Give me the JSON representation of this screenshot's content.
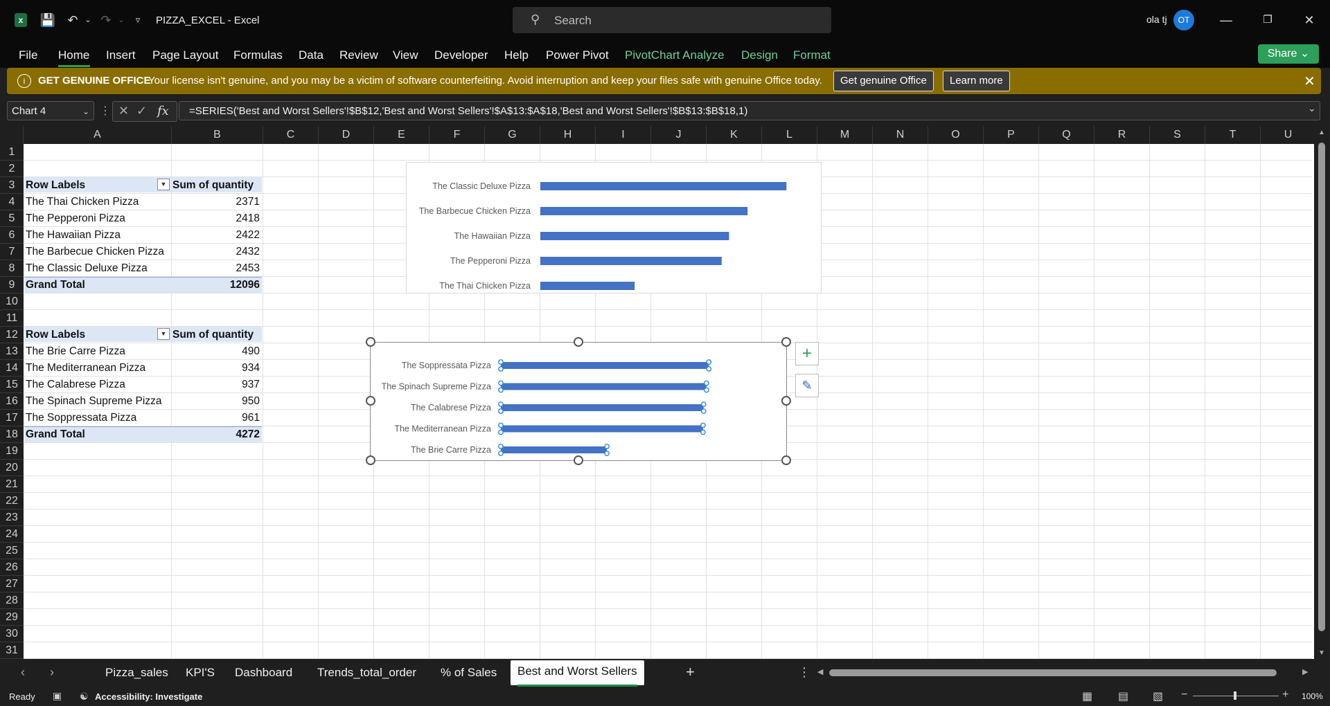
{
  "window": {
    "doc_title": "PIZZA_EXCEL  -  Excel",
    "search_placeholder": "Search",
    "user_name": "ola tj",
    "user_initials": "OT"
  },
  "ribbon": {
    "tabs": [
      "File",
      "Home",
      "Insert",
      "Page Layout",
      "Formulas",
      "Data",
      "Review",
      "View",
      "Developer",
      "Help",
      "Power Pivot",
      "PivotChart Analyze",
      "Design",
      "Format"
    ],
    "active_tab": "Home",
    "share_label": "Share"
  },
  "banner": {
    "heading": "GET GENUINE OFFICE",
    "message": "Your license isn't genuine, and you may be a victim of software counterfeiting. Avoid interruption and keep your files safe with genuine Office today.",
    "btn_primary": "Get genuine Office",
    "btn_secondary": "Learn more"
  },
  "formula_bar": {
    "name_box": "Chart 4",
    "formula": "=SERIES('Best and Worst Sellers'!$B$12,'Best and Worst Sellers'!$A$13:$A$18,'Best and Worst Sellers'!$B$13:$B$18,1)"
  },
  "columns": [
    "A",
    "B",
    "C",
    "D",
    "E",
    "F",
    "G",
    "H",
    "I",
    "J",
    "K",
    "L",
    "M",
    "N",
    "O",
    "P",
    "Q",
    "R",
    "S",
    "T",
    "U"
  ],
  "rows": [
    "1",
    "2",
    "3",
    "4",
    "5",
    "6",
    "7",
    "8",
    "9",
    "10",
    "11",
    "12",
    "13",
    "14",
    "15",
    "16",
    "17",
    "18",
    "19",
    "20",
    "21",
    "22",
    "23",
    "24",
    "25",
    "26",
    "27",
    "28",
    "29",
    "30",
    "31"
  ],
  "pivot1": {
    "hdr_label": "Row Labels",
    "hdr_value": "Sum of quantity",
    "rows": [
      {
        "name": "The Thai Chicken Pizza",
        "value": "2371"
      },
      {
        "name": "The Pepperoni Pizza",
        "value": "2418"
      },
      {
        "name": "The Hawaiian Pizza",
        "value": "2422"
      },
      {
        "name": "The Barbecue Chicken Pizza",
        "value": "2432"
      },
      {
        "name": "The Classic Deluxe Pizza",
        "value": "2453"
      }
    ],
    "total_label": "Grand Total",
    "total_value": "12096"
  },
  "pivot2": {
    "hdr_label": "Row Labels",
    "hdr_value": "Sum of quantity",
    "rows": [
      {
        "name": "The Brie Carre Pizza",
        "value": "490"
      },
      {
        "name": "The Mediterranean Pizza",
        "value": "934"
      },
      {
        "name": "The Calabrese Pizza",
        "value": "937"
      },
      {
        "name": "The Spinach Supreme Pizza",
        "value": "950"
      },
      {
        "name": "The Soppressata Pizza",
        "value": "961"
      }
    ],
    "total_label": "Grand Total",
    "total_value": "4272"
  },
  "chart_data": [
    {
      "type": "bar",
      "orientation": "horizontal",
      "categories": [
        "The Classic Deluxe Pizza",
        "The Barbecue Chicken Pizza",
        "The Hawaiian Pizza",
        "The Pepperoni Pizza",
        "The Thai Chicken Pizza"
      ],
      "values": [
        2453,
        2432,
        2422,
        2418,
        2371
      ],
      "xlim": [
        2320,
        2460
      ],
      "ticks": [
        "2320",
        "2340",
        "2360",
        "2380",
        "2400",
        "2420",
        "2440",
        "2460"
      ],
      "color": "#4472c4"
    },
    {
      "type": "bar",
      "orientation": "horizontal",
      "categories": [
        "The Soppressata Pizza",
        "The Spinach Supreme Pizza",
        "The Calabrese Pizza",
        "The Mediterranean Pizza",
        "The Brie Carre Pizza"
      ],
      "values": [
        961,
        950,
        937,
        934,
        490
      ],
      "xlim": [
        0,
        1200
      ],
      "ticks": [
        "0",
        "200",
        "400",
        "600",
        "800",
        "1000",
        "1200"
      ],
      "color": "#4472c4"
    }
  ],
  "sheet_tabs": [
    "Pizza_sales",
    "KPI'S",
    "Dashboard",
    "Trends_total_order",
    "% of Sales",
    "Best and Worst Sellers"
  ],
  "active_sheet": "Best and Worst Sellers",
  "status": {
    "ready": "Ready",
    "accessibility": "Accessibility: Investigate",
    "zoom": "100%"
  }
}
